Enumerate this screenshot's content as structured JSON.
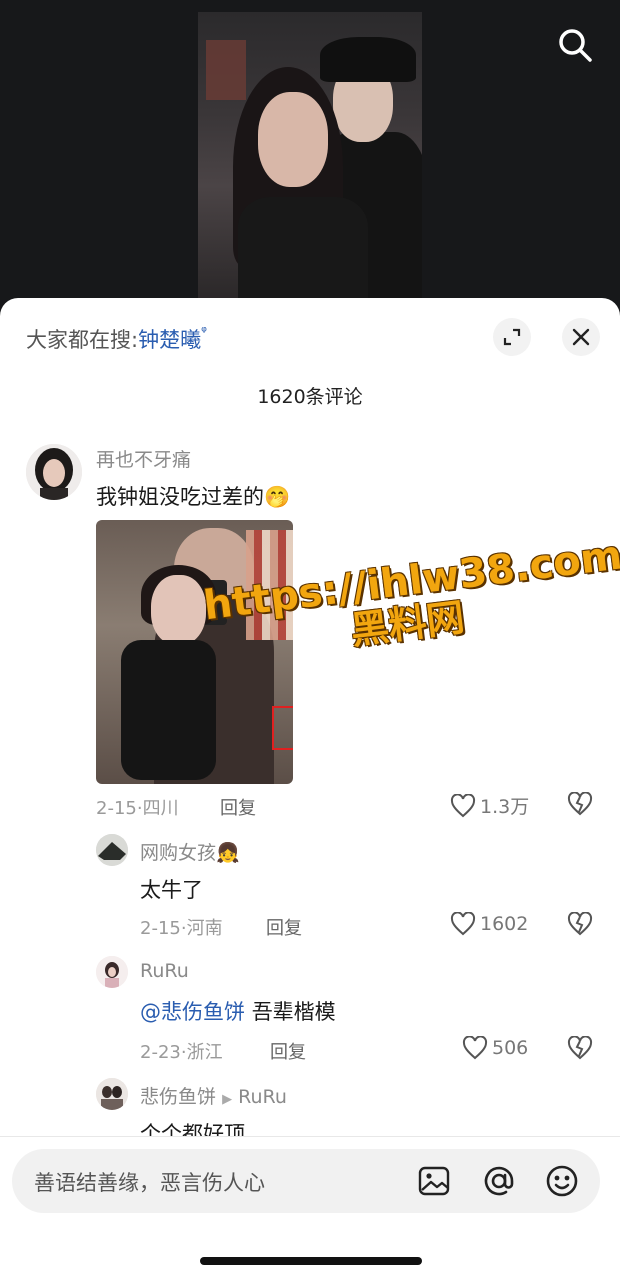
{
  "video": {
    "search_icon": "search-icon"
  },
  "hot_search": {
    "prefix": "大家都在搜:",
    "term": "钟楚曦",
    "term_icon": "ᵠ"
  },
  "comment_count": "1620条评论",
  "comments": [
    {
      "user": "再也不牙痛",
      "text": "我钟姐没吃过差的",
      "emoji": "🤭",
      "date": "2-15",
      "location": "四川",
      "reply_label": "回复",
      "likes": "1.3万"
    },
    {
      "user": "网购女孩",
      "user_emoji": "👧",
      "text": "太牛了",
      "date": "2-15",
      "location": "河南",
      "reply_label": "回复",
      "likes": "1602"
    },
    {
      "user": "RuRu",
      "mention": "@悲伤鱼饼",
      "text": "吾辈楷模",
      "date": "2-23",
      "location": "浙江",
      "reply_label": "回复",
      "likes": "506"
    },
    {
      "user": "悲伤鱼饼",
      "reply_to": "RuRu",
      "text": "个个都好顶"
    }
  ],
  "watermark": {
    "line1": "https://ihlw38.com",
    "line2": "黑料网"
  },
  "input": {
    "placeholder": "善语结善缘，恶言伤人心"
  },
  "colors": {
    "link": "#2a5db0",
    "watermark": "#f2a60f"
  }
}
